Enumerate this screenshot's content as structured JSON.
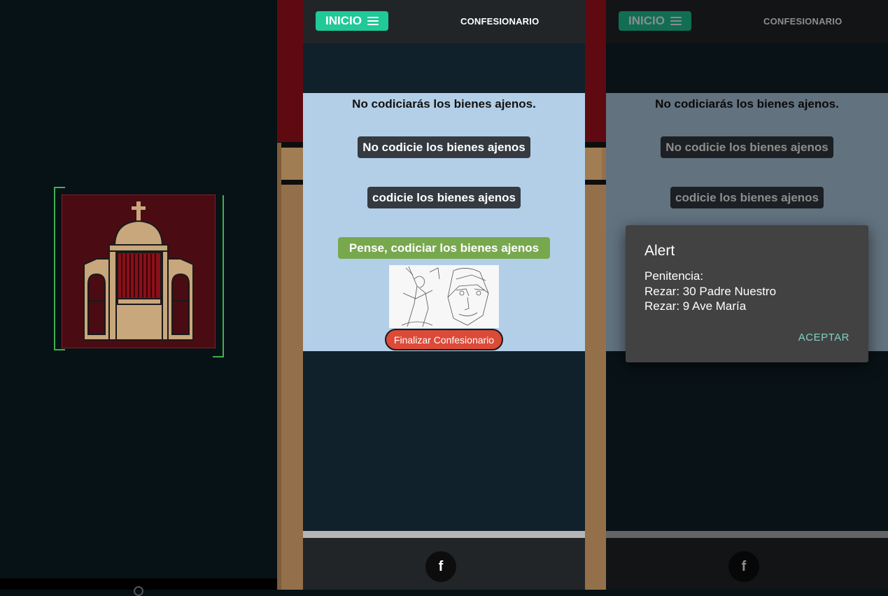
{
  "screens": {
    "main": {
      "header": {
        "home_label": "INICIO",
        "title": "CONFESIONARIO"
      },
      "question": "No codiciarás los bienes ajenos.",
      "options": [
        "No codicie los bienes ajenos",
        "codicie los bienes ajenos",
        "Pense, codiciar los bienes ajenos"
      ],
      "finish_label": "Finalizar Confesionario",
      "footer": {
        "facebook_label": "f"
      }
    },
    "alert_view": {
      "header": {
        "home_label": "INICIO",
        "title": "CONFESIONARIO"
      },
      "question": "No codiciarás los bienes ajenos.",
      "options": [
        "No codicie los bienes ajenos",
        "codicie los bienes ajenos"
      ],
      "footer": {
        "facebook_label": "f"
      },
      "alert": {
        "title": "Alert",
        "lines": [
          "Penitencia:",
          "Rezar: 30 Padre Nuestro",
          "Rezar: 9 Ave María"
        ],
        "ok_label": "ACEPTAR"
      }
    }
  },
  "icons": {
    "menu": "menu-icon",
    "facebook": "facebook-icon",
    "splash_logo": "confessional-icon"
  },
  "colors": {
    "inicio": "#20c997",
    "option_dark": "#343a40",
    "option_green": "#78a84e",
    "finish": "#dc4a38",
    "content_bg": "#b3cfe8",
    "alert_ok": "#7fd3c2"
  }
}
